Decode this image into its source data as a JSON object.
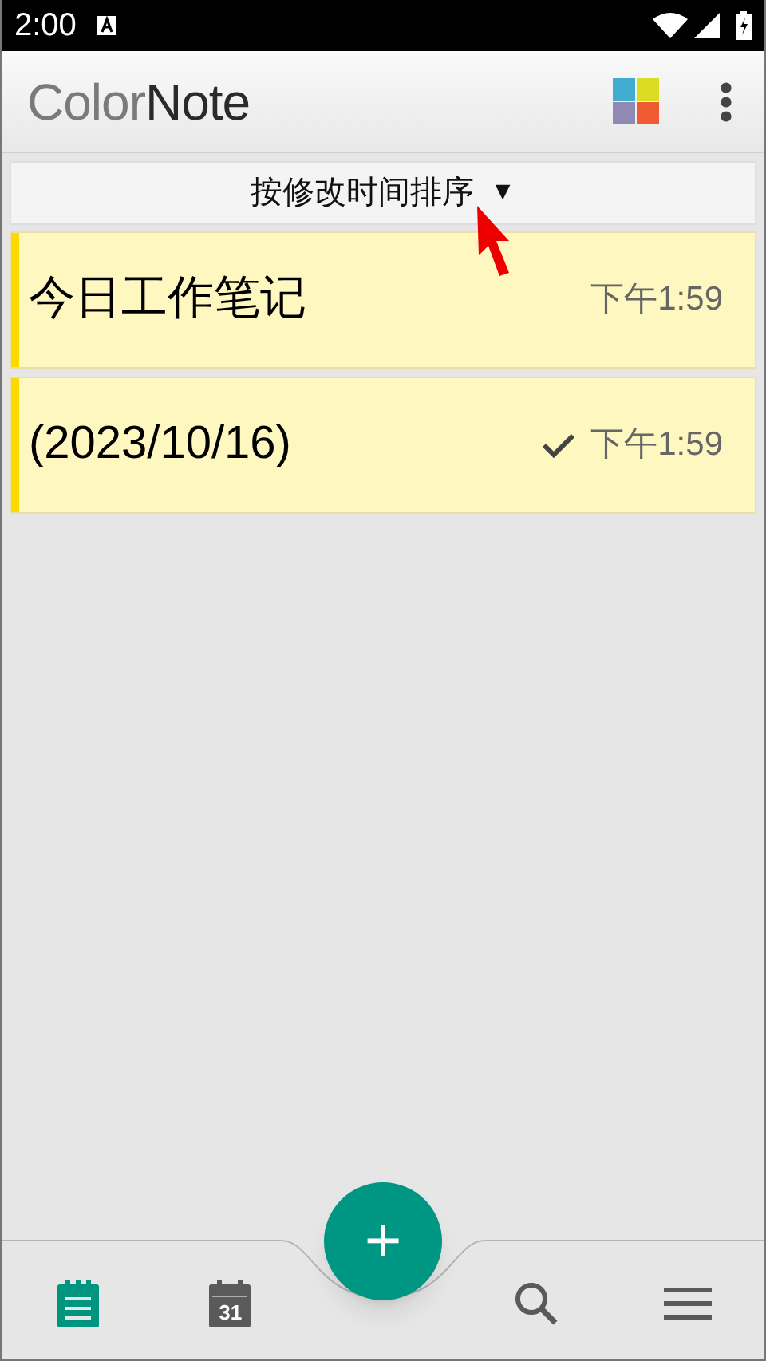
{
  "status_bar": {
    "time": "2:00"
  },
  "app_bar": {
    "logo_parts": [
      "Color",
      "Note"
    ]
  },
  "sort_bar": {
    "label": "按修改时间排序",
    "arrow": "▼"
  },
  "notes": [
    {
      "title": "今日工作笔记",
      "time": "下午1:59",
      "checked": false,
      "color": "#ffd800"
    },
    {
      "title": "(2023/10/16)",
      "time": "下午1:59",
      "checked": true,
      "color": "#ffd800"
    }
  ],
  "fab": {
    "label": "+"
  },
  "bottom_nav": [
    {
      "kind": "notes",
      "selected": true
    },
    {
      "kind": "calendar",
      "selected": false,
      "day": "31"
    },
    {
      "kind": "gap"
    },
    {
      "kind": "search",
      "selected": false
    },
    {
      "kind": "menu",
      "selected": false
    }
  ]
}
